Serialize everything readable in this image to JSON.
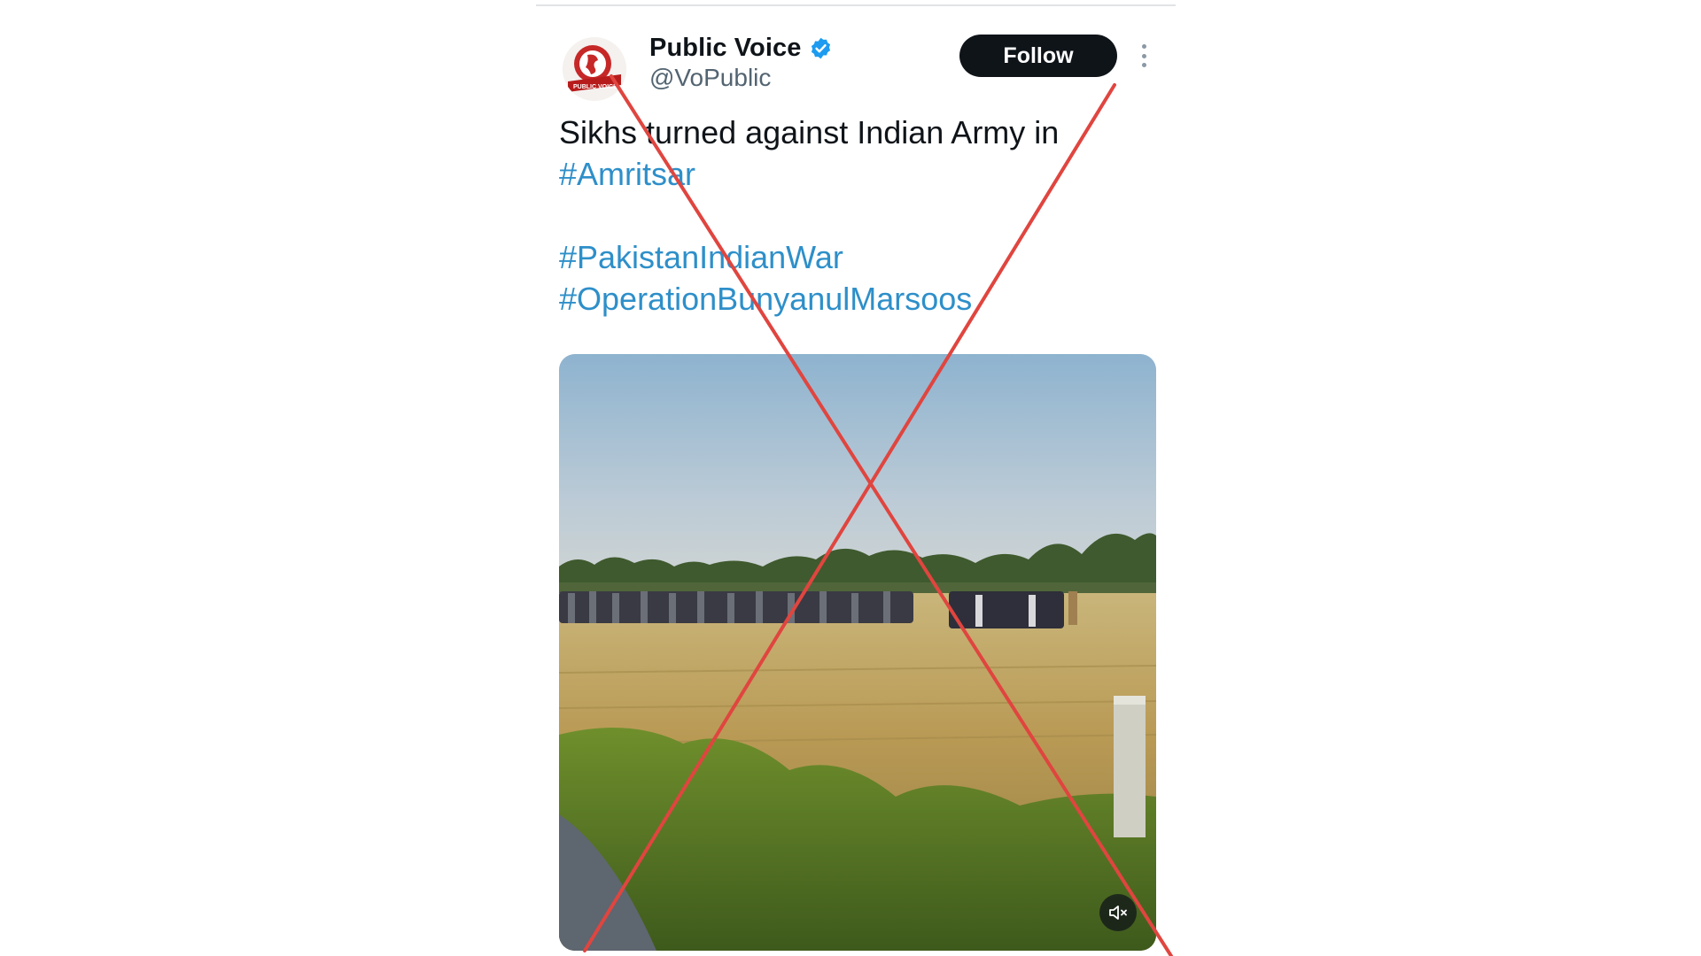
{
  "tweet": {
    "author": {
      "name": "Public Voice",
      "handle": "@VoPublic",
      "avatar_text": "PUBLIC VOICE",
      "verified": true
    },
    "follow_label": "Follow",
    "text": {
      "line1": "Sikhs turned against Indian Army in",
      "hashtag1": "#Amritsar",
      "hashtag2": "#PakistanIndianWar",
      "hashtag3": "#OperationBunyanulMarsoos"
    },
    "media": {
      "type": "video",
      "muted": true
    }
  },
  "overlay": {
    "mark": "red-cross",
    "color": "#e0453f"
  },
  "colors": {
    "follow_bg": "#0f1419",
    "hashtag": "#2e8fc9",
    "verified": "#1d9bf0"
  }
}
